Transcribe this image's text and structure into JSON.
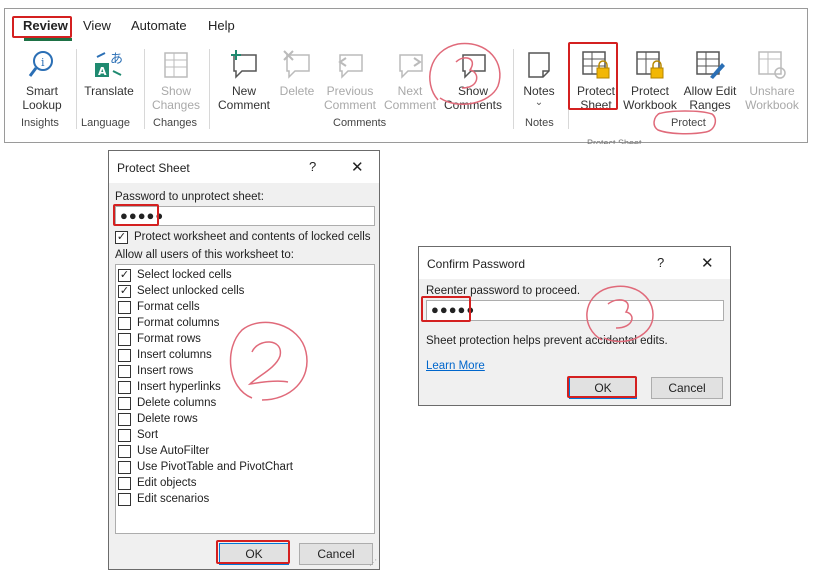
{
  "ribbon": {
    "tabs": [
      "Review",
      "View",
      "Automate",
      "Help"
    ],
    "buttons": {
      "smart_lookup": [
        "Smart",
        "Lookup"
      ],
      "translate": [
        "Translate"
      ],
      "show_changes": [
        "Show",
        "Changes"
      ],
      "new_comment": [
        "New",
        "Comment"
      ],
      "delete": [
        "Delete"
      ],
      "previous_comment": [
        "Previous",
        "Comment"
      ],
      "next_comment": [
        "Next",
        "Comment"
      ],
      "show_comments": [
        "Show",
        "Comments"
      ],
      "notes": [
        "Notes"
      ],
      "protect_sheet": [
        "Protect",
        "Sheet"
      ],
      "protect_workbook": [
        "Protect",
        "Workbook"
      ],
      "allow_edit_ranges": [
        "Allow Edit",
        "Ranges"
      ],
      "unshare_workbook": [
        "Unshare",
        "Workbook"
      ]
    },
    "groups": [
      "Insights",
      "Language",
      "Changes",
      "Comments",
      "Notes",
      "Protect"
    ],
    "tooltip_fragment": "Protect Sheet"
  },
  "protect_sheet_dialog": {
    "title": "Protect Sheet",
    "help": "?",
    "close": "✕",
    "password_label": "Password to unprotect sheet:",
    "password_value": "●●●●●",
    "protect_checkbox_label": "Protect worksheet and contents of locked cells",
    "allow_label": "Allow all users of this worksheet to:",
    "options": [
      {
        "label": "Select locked cells",
        "checked": true
      },
      {
        "label": "Select unlocked cells",
        "checked": true
      },
      {
        "label": "Format cells",
        "checked": false
      },
      {
        "label": "Format columns",
        "checked": false
      },
      {
        "label": "Format rows",
        "checked": false
      },
      {
        "label": "Insert columns",
        "checked": false
      },
      {
        "label": "Insert rows",
        "checked": false
      },
      {
        "label": "Insert hyperlinks",
        "checked": false
      },
      {
        "label": "Delete columns",
        "checked": false
      },
      {
        "label": "Delete rows",
        "checked": false
      },
      {
        "label": "Sort",
        "checked": false
      },
      {
        "label": "Use AutoFilter",
        "checked": false
      },
      {
        "label": "Use PivotTable and PivotChart",
        "checked": false
      },
      {
        "label": "Edit objects",
        "checked": false
      },
      {
        "label": "Edit scenarios",
        "checked": false
      }
    ],
    "ok_label": "OK",
    "cancel_label": "Cancel"
  },
  "confirm_password_dialog": {
    "title": "Confirm Password",
    "help": "?",
    "close": "✕",
    "reenter_label": "Reenter password to proceed.",
    "password_value": "●●●●●",
    "info": "Sheet protection helps prevent accidental edits.",
    "learn_more": "Learn More",
    "ok_label": "OK",
    "cancel_label": "Cancel"
  },
  "colors": {
    "highlight": "#d42020",
    "annotation": "#e06a7a",
    "excel_green": "#1e7145",
    "link": "#0066cc"
  }
}
